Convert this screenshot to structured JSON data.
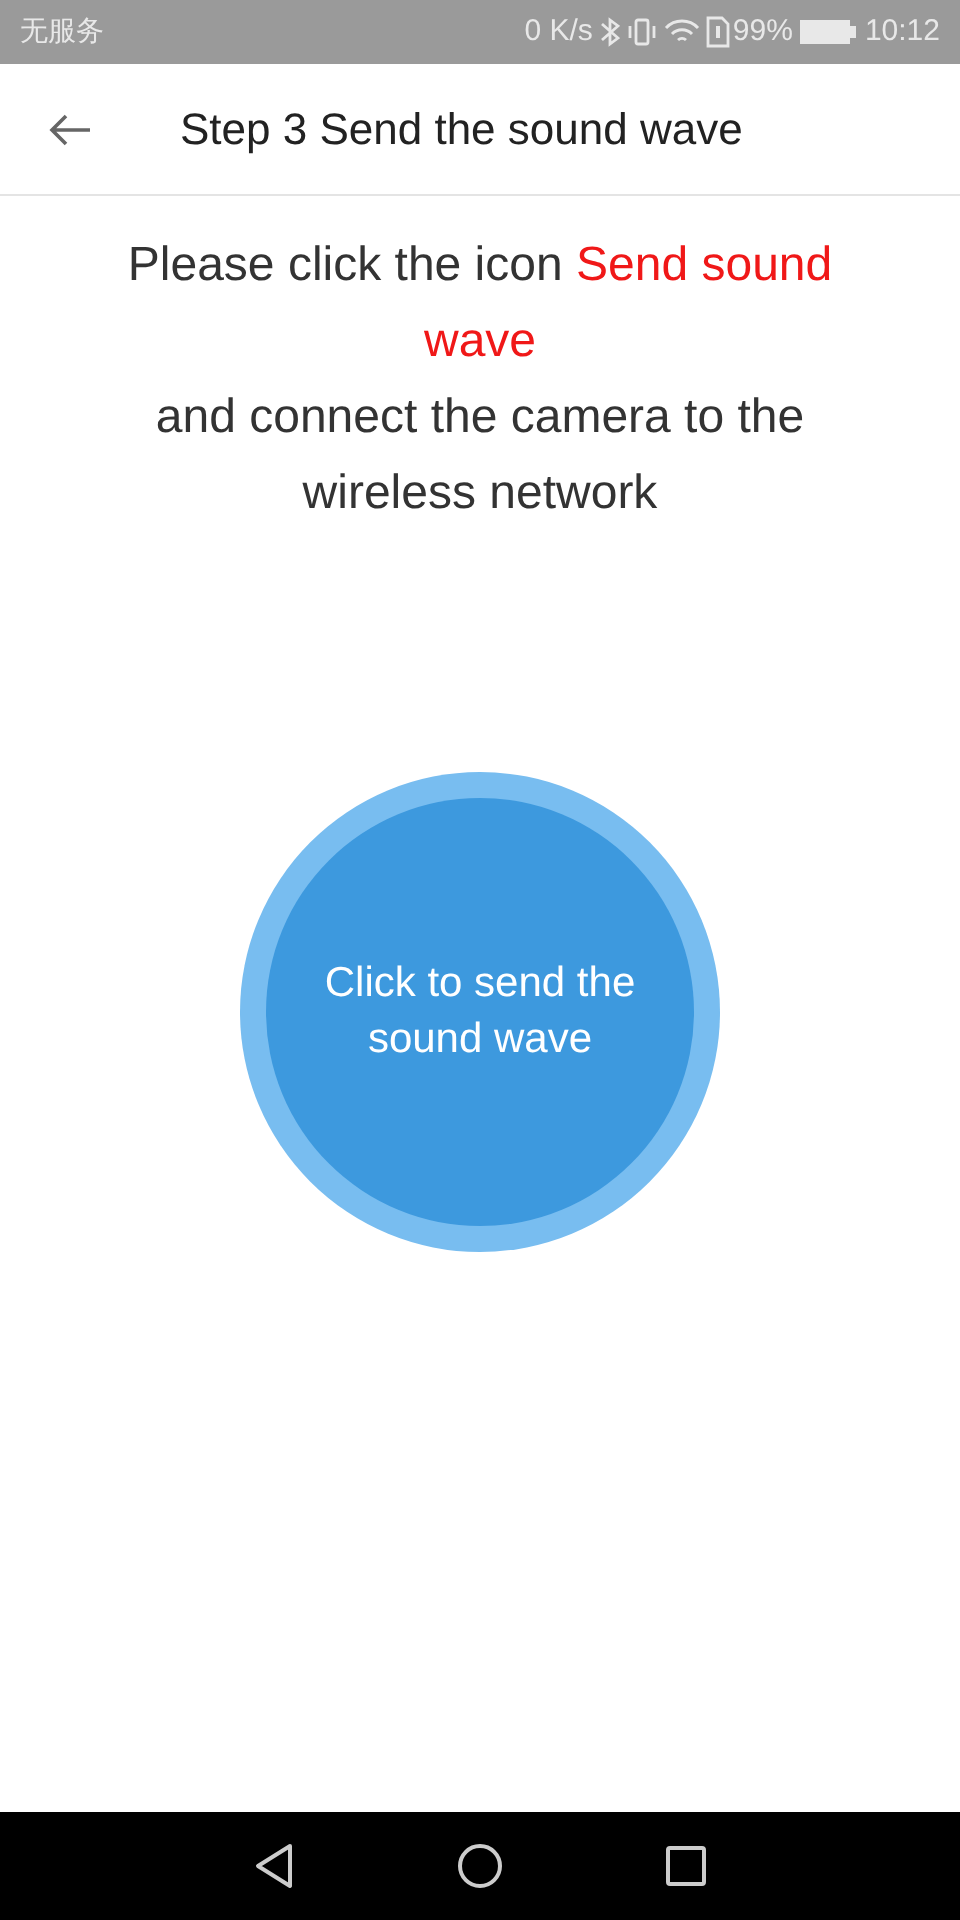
{
  "status_bar": {
    "carrier": "无服务",
    "speed": "0 K/s",
    "battery": "99%",
    "time": "10:12"
  },
  "header": {
    "title": "Step 3 Send the sound wave"
  },
  "instruction": [
    {
      "text": "Please click the icon ",
      "highlight": false
    },
    {
      "text": "Send sound wave",
      "highlight": true
    },
    {
      "text": "\nand connect the camera to the wireless network",
      "highlight": false
    }
  ],
  "send_button": {
    "label": "Click to send the sound wave"
  }
}
